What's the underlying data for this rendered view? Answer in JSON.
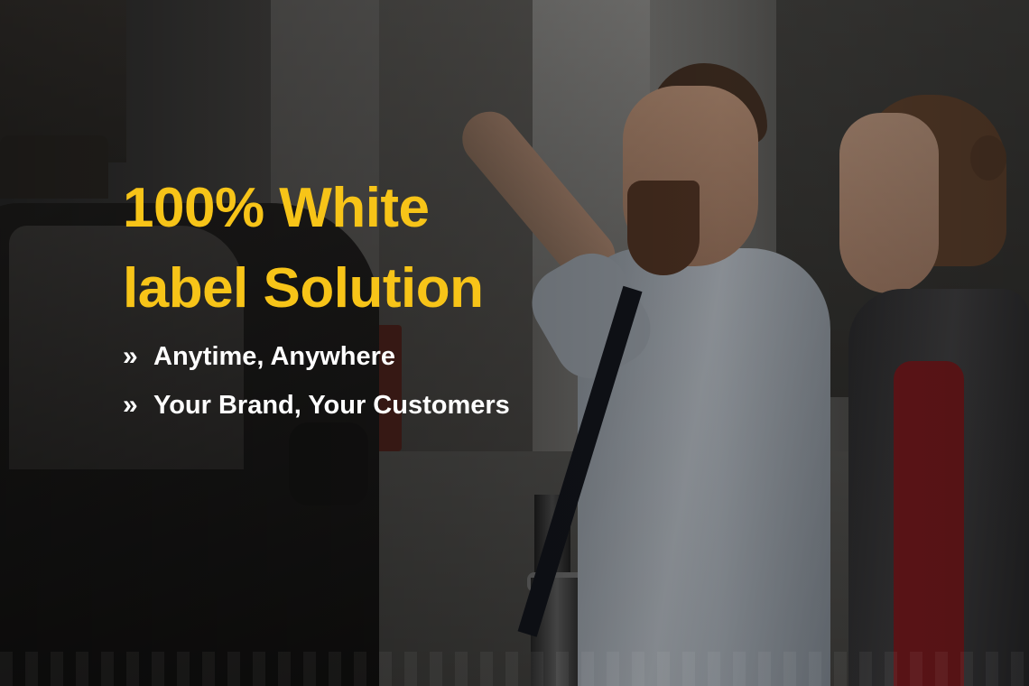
{
  "hero": {
    "headline_line1": "100% White",
    "headline_line2": "label Solution",
    "bullets": [
      {
        "marker": "»",
        "text": "Anytime, Anywhere"
      },
      {
        "marker": "»",
        "text": "Your Brand, Your Customers"
      }
    ]
  },
  "colors": {
    "headline": "#f7c418",
    "bullet_text": "#ffffff"
  }
}
